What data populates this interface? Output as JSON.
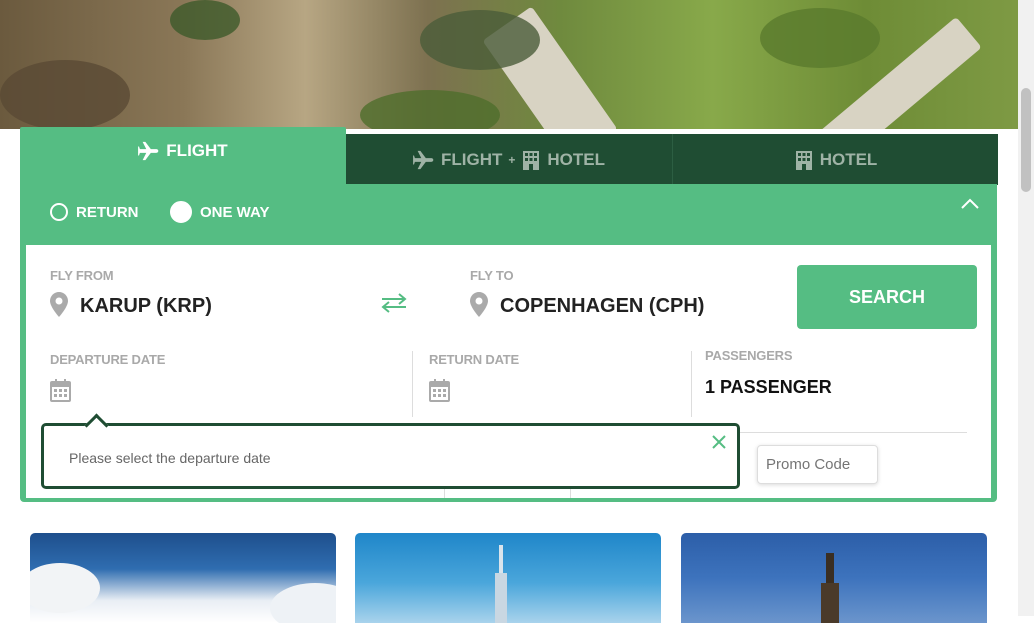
{
  "tabs": [
    {
      "label": "FLIGHT",
      "active": true
    },
    {
      "label_a": "FLIGHT",
      "plus": "+",
      "label_b": "HOTEL",
      "active": false
    },
    {
      "label": "HOTEL",
      "active": false
    }
  ],
  "trip_type": {
    "return_label": "RETURN",
    "oneway_label": "ONE WAY",
    "selected": "ONE WAY"
  },
  "fly_from": {
    "label": "FLY FROM",
    "value": "KARUP (KRP)"
  },
  "fly_to": {
    "label": "FLY TO",
    "value": "COPENHAGEN (CPH)"
  },
  "search_label": "SEARCH",
  "departure": {
    "label": "DEPARTURE DATE",
    "value": ""
  },
  "return_date": {
    "label": "RETURN DATE",
    "value": ""
  },
  "passengers": {
    "label": "PASSENGERS",
    "value": "1 PASSENGER"
  },
  "promo": {
    "placeholder": "Promo Code"
  },
  "tooltip": {
    "message": "Please select the departure date"
  },
  "colors": {
    "accent": "#55bd83",
    "dark": "#1f4d33"
  }
}
